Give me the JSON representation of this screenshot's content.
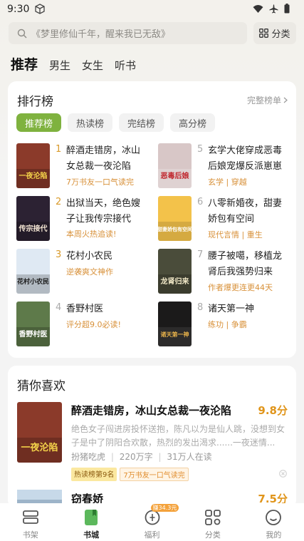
{
  "status_bar": {
    "time": "9:30"
  },
  "search": {
    "placeholder": "《梦里修仙千年，醒来我已无敌》",
    "category_label": "分类"
  },
  "top_tabs": [
    {
      "label": "推荐",
      "active": true
    },
    {
      "label": "男生",
      "active": false
    },
    {
      "label": "女生",
      "active": false
    },
    {
      "label": "听书",
      "active": false
    }
  ],
  "ranking": {
    "title": "排行榜",
    "more_label": "完整榜单",
    "tabs": [
      {
        "label": "推荐榜",
        "active": true
      },
      {
        "label": "热读榜",
        "active": false
      },
      {
        "label": "完结榜",
        "active": false
      },
      {
        "label": "高分榜",
        "active": false
      }
    ],
    "items": [
      {
        "rank": "1",
        "name": "醉酒走错房，冰山女总裁一夜沦陷",
        "tag": "7万书友一口气读完"
      },
      {
        "rank": "2",
        "name": "出狱当天，绝色嫂子让我传宗接代",
        "tag": "本周火热追读!"
      },
      {
        "rank": "3",
        "name": "花村小农民",
        "tag": "逆袭爽文神作"
      },
      {
        "rank": "4",
        "name": "香野村医",
        "tag": "评分超9.0必读!"
      },
      {
        "rank": "5",
        "name": "玄学大佬穿成恶毒后娘宠爆反派崽崽",
        "tag": "玄学 | 穿越"
      },
      {
        "rank": "6",
        "name": "八零新婚夜，甜妻娇包有空间",
        "tag": "现代言情 | 重生"
      },
      {
        "rank": "7",
        "name": "腰子被噶，移植龙肾后我强势归来",
        "tag": "作者爆更连更44天"
      },
      {
        "rank": "8",
        "name": "诸天第一神",
        "tag": "练功 | 争霸"
      }
    ],
    "covers": [
      {
        "text": "一夜沦陷",
        "bg": "#8b3a2a",
        "fg": "#f4d34a"
      },
      {
        "text": "传宗接代",
        "bg": "#2c2233",
        "fg": "#f0e2d0"
      },
      {
        "text": "花村小农民",
        "bg": "#dfe9f3",
        "fg": "#1a1a1a"
      },
      {
        "text": "香野村医",
        "bg": "#5e7a4a",
        "fg": "#ffffff"
      },
      {
        "text": "恶毒后娘",
        "bg": "#d8c7c7",
        "fg": "#c0262d"
      },
      {
        "text": "甜妻娇包有空间",
        "bg": "#f3c24a",
        "fg": "#ffffff"
      },
      {
        "text": "龙肾归来",
        "bg": "#4a4c3a",
        "fg": "#f2e9c8"
      },
      {
        "text": "诸天第一神",
        "bg": "#1b1a1a",
        "fg": "#e8b24a"
      }
    ]
  },
  "guess": {
    "title": "猜你喜欢",
    "book": {
      "name": "醉酒走错房，冰山女总裁一夜沦陷",
      "score": "9.8分",
      "description": "绝色女子闯进房投怀送抱，陈凡以为是仙人跳，没想到女子是中了阴阳合欢散，热烈的发出渴求......一夜迷情...",
      "author": "扮猪吃虎",
      "words": "220万字",
      "readers": "31万人在读",
      "badges": [
        "热读榜第9名",
        "7万书友一口气读完"
      ]
    },
    "book2": {
      "name": "窃春娇",
      "score": "7.5分"
    }
  },
  "bottom_nav": [
    {
      "label": "书架",
      "active": false
    },
    {
      "label": "书城",
      "active": true
    },
    {
      "label": "福利",
      "active": false,
      "badge": "赚34.3元"
    },
    {
      "label": "分类",
      "active": false
    },
    {
      "label": "我的",
      "active": false
    }
  ],
  "colors": {
    "accent_green": "#7fb23f",
    "rank_gold": "#d99a2a",
    "tag_orange": "#d8913a",
    "score_orange": "#e0951b"
  }
}
